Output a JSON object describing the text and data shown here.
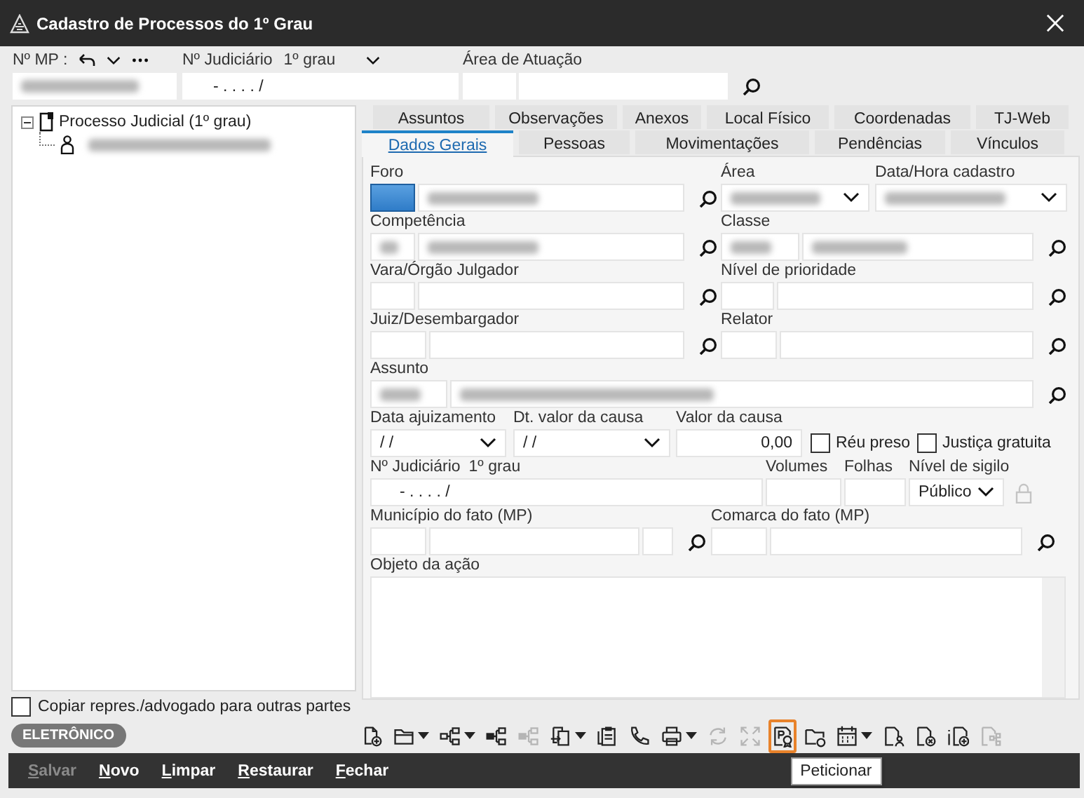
{
  "window": {
    "title": "Cadastro de Processos do 1º Grau"
  },
  "header": {
    "mp_label": "Nº MP :",
    "judiciario_label": "Nº Judiciário",
    "judiciario_grau": "1º grau",
    "judiciario_value": "- .   . . .   /",
    "area_label": "Área de Atuação"
  },
  "tree": [
    {
      "label": "Processo Judicial (1º grau)",
      "expanded": true,
      "children": [
        {
          "redacted": true
        }
      ]
    }
  ],
  "copy_option": {
    "label": "Copiar repres./advogado para outras partes",
    "checked": false
  },
  "badge": "ELETRÔNICO",
  "tabs_back": [
    {
      "label": "Assuntos",
      "selected": false
    },
    {
      "label": "Observações",
      "selected": false
    },
    {
      "label": "Anexos",
      "selected": false
    },
    {
      "label": "Local Físico",
      "selected": false
    },
    {
      "label": "Coordenadas",
      "selected": false
    },
    {
      "label": "TJ-Web",
      "selected": false
    }
  ],
  "tabs_front": [
    {
      "label": "Dados Gerais",
      "selected": true
    },
    {
      "label": "Pessoas",
      "selected": false
    },
    {
      "label": "Movimentações",
      "selected": false
    },
    {
      "label": "Pendências",
      "selected": false
    },
    {
      "label": "Vínculos",
      "selected": false
    }
  ],
  "form": [
    [
      {
        "label": "Foro",
        "kind": "lookup",
        "redacted": true,
        "focused": true
      },
      {
        "label": "Área",
        "kind": "select",
        "redacted": true
      },
      {
        "label": "Data/Hora cadastro",
        "kind": "select",
        "redacted": true
      }
    ],
    [
      {
        "label": "Competência",
        "kind": "lookup",
        "redacted": true
      },
      {
        "label": "Classe",
        "kind": "lookup",
        "redacted": true
      }
    ],
    [
      {
        "label": "Vara/Órgão Julgador",
        "kind": "lookup"
      },
      {
        "label": "Nível de prioridade",
        "kind": "lookup"
      }
    ],
    [
      {
        "label": "Juiz/Desembargador",
        "kind": "lookup"
      },
      {
        "label": "Relator",
        "kind": "lookup"
      }
    ],
    [
      {
        "label": "Assunto",
        "kind": "lookup",
        "redacted": true
      }
    ],
    [
      {
        "label": "Data ajuizamento",
        "kind": "select",
        "value": "/ /"
      },
      {
        "label": "Dt. valor da causa",
        "kind": "select",
        "value": "/ /"
      },
      {
        "label": "Valor da causa",
        "kind": "number",
        "value": "0,00"
      },
      {
        "label": "Réu preso",
        "kind": "checkbox",
        "checked": false
      },
      {
        "label": "Justiça gratuita",
        "kind": "checkbox",
        "checked": false
      }
    ],
    [
      {
        "label": "Nº Judiciário",
        "sublabel": "1º grau",
        "kind": "text",
        "value": "- .   . . .   /"
      },
      {
        "label": "Volumes",
        "kind": "text"
      },
      {
        "label": "Folhas",
        "kind": "text"
      },
      {
        "label": "Nível de sigilo",
        "kind": "select",
        "value": "Público",
        "lock_enabled": false
      }
    ],
    [
      {
        "label": "Município do fato (MP)",
        "kind": "lookup"
      },
      {
        "label": "Comarca do fato (MP)",
        "kind": "lookup"
      }
    ],
    [
      {
        "label": "Objeto da ação",
        "kind": "textarea"
      }
    ]
  ],
  "toolbar": [
    {
      "kind": "doc-plus",
      "dropdown": false,
      "disabled": false,
      "highlighted": false
    },
    {
      "kind": "folder",
      "dropdown": true,
      "disabled": false,
      "highlighted": false
    },
    {
      "kind": "tree",
      "dropdown": true,
      "disabled": false,
      "highlighted": false
    },
    {
      "kind": "tree-filled",
      "dropdown": false,
      "disabled": false,
      "highlighted": false
    },
    {
      "kind": "tree-filled",
      "dropdown": false,
      "disabled": true,
      "highlighted": false
    },
    {
      "kind": "docs-arrow",
      "dropdown": true,
      "disabled": false,
      "highlighted": false
    },
    {
      "kind": "clipboard",
      "dropdown": false,
      "disabled": false,
      "highlighted": false
    },
    {
      "kind": "phone",
      "dropdown": false,
      "disabled": false,
      "highlighted": false
    },
    {
      "kind": "printer",
      "dropdown": true,
      "disabled": false,
      "highlighted": false
    },
    {
      "kind": "refresh",
      "dropdown": false,
      "disabled": true,
      "highlighted": false
    },
    {
      "kind": "expand",
      "dropdown": false,
      "disabled": true,
      "highlighted": false
    },
    {
      "kind": "petition",
      "dropdown": false,
      "disabled": false,
      "highlighted": true
    },
    {
      "kind": "folder-clock",
      "dropdown": false,
      "disabled": false,
      "highlighted": false
    },
    {
      "kind": "calendar",
      "dropdown": true,
      "disabled": false,
      "highlighted": false
    },
    {
      "kind": "doc-person",
      "dropdown": false,
      "disabled": false,
      "highlighted": false
    },
    {
      "kind": "doc-x",
      "dropdown": false,
      "disabled": false,
      "highlighted": false
    },
    {
      "kind": "doc-info",
      "dropdown": false,
      "disabled": false,
      "highlighted": false
    },
    {
      "kind": "doc-tree",
      "dropdown": false,
      "disabled": true,
      "highlighted": false
    }
  ],
  "tooltip": "Peticionar",
  "actions": [
    {
      "label": "Salvar",
      "disabled": true
    },
    {
      "label": "Novo",
      "disabled": false
    },
    {
      "label": "Limpar",
      "disabled": false
    },
    {
      "label": "Restaurar",
      "disabled": false
    },
    {
      "label": "Fechar",
      "disabled": false
    }
  ]
}
